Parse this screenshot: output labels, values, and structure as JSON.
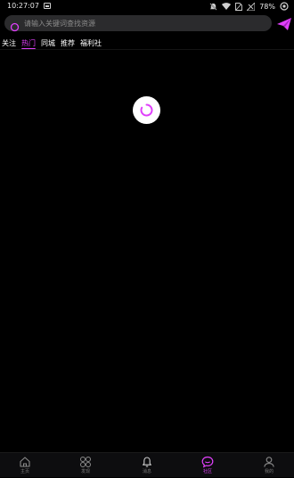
{
  "status_bar": {
    "time": "10:27:07",
    "battery": "78%"
  },
  "search": {
    "placeholder": "请输入关键词查找资源"
  },
  "tabs": [
    {
      "label": "关注",
      "active": false
    },
    {
      "label": "热门",
      "active": true
    },
    {
      "label": "同城",
      "active": false
    },
    {
      "label": "推荐",
      "active": false
    },
    {
      "label": "福利社",
      "active": false
    }
  ],
  "bottom_nav": [
    {
      "label": "主页",
      "icon": "home-icon",
      "active": false
    },
    {
      "label": "发现",
      "icon": "grid-icon",
      "active": false
    },
    {
      "label": "消息",
      "icon": "bell-icon",
      "active": false
    },
    {
      "label": "社区",
      "icon": "chat-bubble-icon",
      "active": true
    },
    {
      "label": "我的",
      "icon": "user-icon",
      "active": false
    }
  ],
  "colors": {
    "accent": "#e040fb",
    "background": "#000000",
    "nav_background": "#0d0d0f",
    "search_background": "#2b2b2d",
    "inactive_label": "#7a7a7a"
  }
}
